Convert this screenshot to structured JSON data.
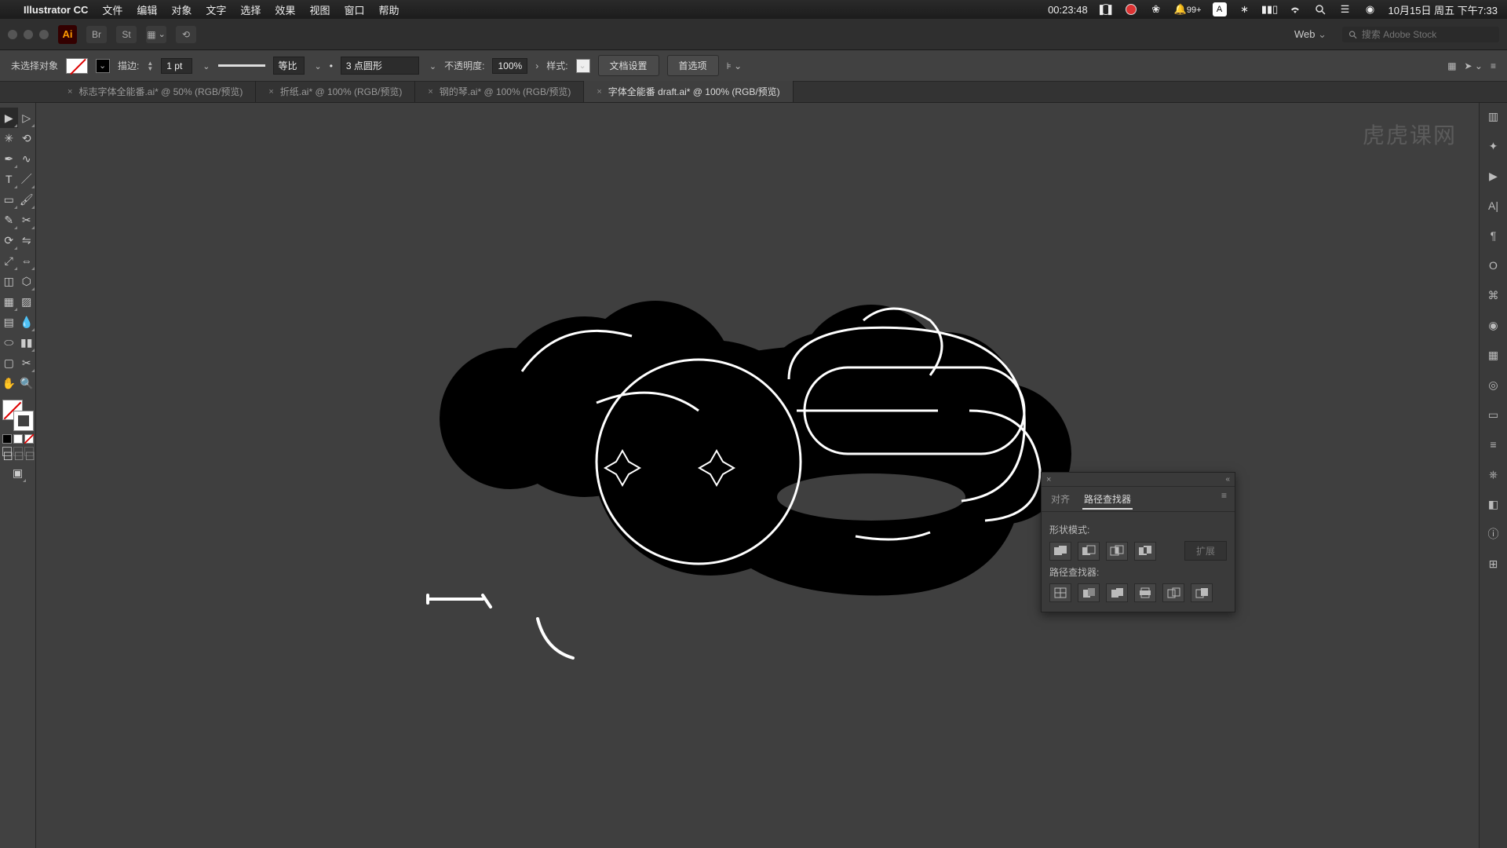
{
  "menubar": {
    "apple": "",
    "app": "Illustrator CC",
    "items": [
      "文件",
      "编辑",
      "对象",
      "文字",
      "选择",
      "效果",
      "视图",
      "窗口",
      "帮助"
    ],
    "timer": "00:23:48",
    "notif": "99+",
    "date": "10月15日 周五 下午7:33"
  },
  "chrome": {
    "ai": "Ai",
    "doc_profile": "Web",
    "search_placeholder": "搜索 Adobe Stock"
  },
  "control": {
    "selection": "未选择对象",
    "stroke_label": "描边:",
    "stroke_weight": "1 pt",
    "stroke_profile": "等比",
    "brush_def": "3 点圆形",
    "opacity_label": "不透明度:",
    "opacity": "100%",
    "style_label": "样式:",
    "doc_setup": "文档设置",
    "prefs": "首选项"
  },
  "tabs": [
    {
      "label": "标志字体全能番.ai* @ 50% (RGB/预览)",
      "active": false
    },
    {
      "label": "折纸.ai* @ 100% (RGB/预览)",
      "active": false
    },
    {
      "label": "钢的琴.ai* @ 100% (RGB/预览)",
      "active": false
    },
    {
      "label": "字体全能番 draft.ai* @ 100% (RGB/预览)",
      "active": true
    }
  ],
  "pathfinder": {
    "tab_align": "对齐",
    "tab_pf": "路径查找器",
    "shape_modes": "形状模式:",
    "pf_label": "路径查找器:",
    "expand": "扩展"
  },
  "watermark": "虎虎课网"
}
